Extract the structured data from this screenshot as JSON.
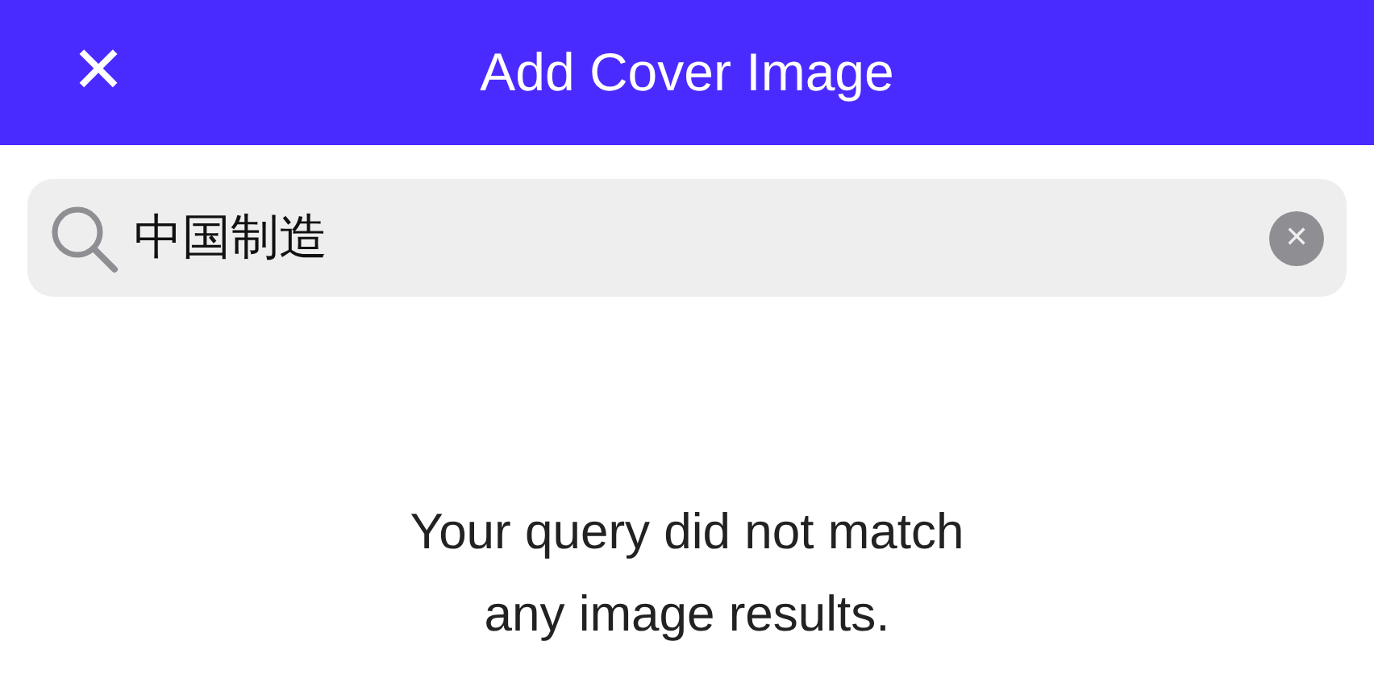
{
  "header": {
    "close": "✕",
    "title": "Add Cover Image"
  },
  "search": {
    "value": "中国制造"
  },
  "message": [
    "Your query did not match",
    "any image results."
  ]
}
